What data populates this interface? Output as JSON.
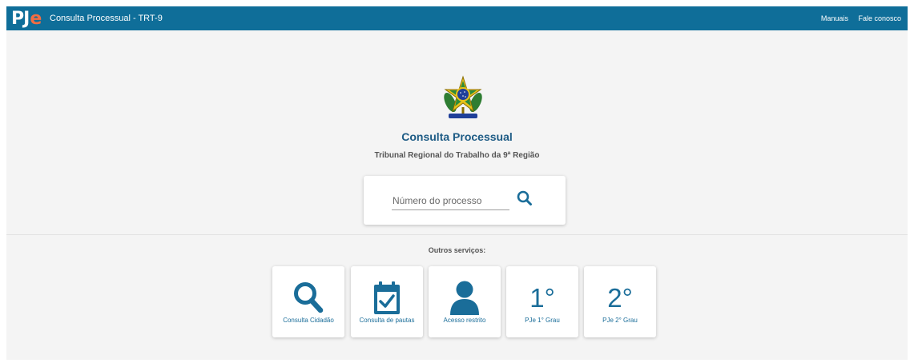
{
  "header": {
    "logo_main": "PJ",
    "logo_accent": "e",
    "title": "Consulta Processual - TRT-9",
    "links": [
      "Manuais",
      "Fale conosco"
    ]
  },
  "main": {
    "title": "Consulta Processual",
    "subtitle": "Tribunal Regional do Trabalho da 9ª Região",
    "search": {
      "placeholder": "Número do processo",
      "value": ""
    }
  },
  "services": {
    "label": "Outros serviços:",
    "items": [
      {
        "label": "Consulta Cidadão",
        "icon": "search-icon"
      },
      {
        "label": "Consulta de pautas",
        "icon": "calendar-check-icon"
      },
      {
        "label": "Acesso restrito",
        "icon": "user-icon"
      },
      {
        "label": "PJe 1° Grau",
        "glyph": "1°"
      },
      {
        "label": "PJe 2° Grau",
        "glyph": "2°"
      }
    ]
  },
  "colors": {
    "header_bg": "#0f6e99",
    "accent": "#1a6d99",
    "logo_accent": "#f26d43",
    "background": "#f4f4f4"
  }
}
